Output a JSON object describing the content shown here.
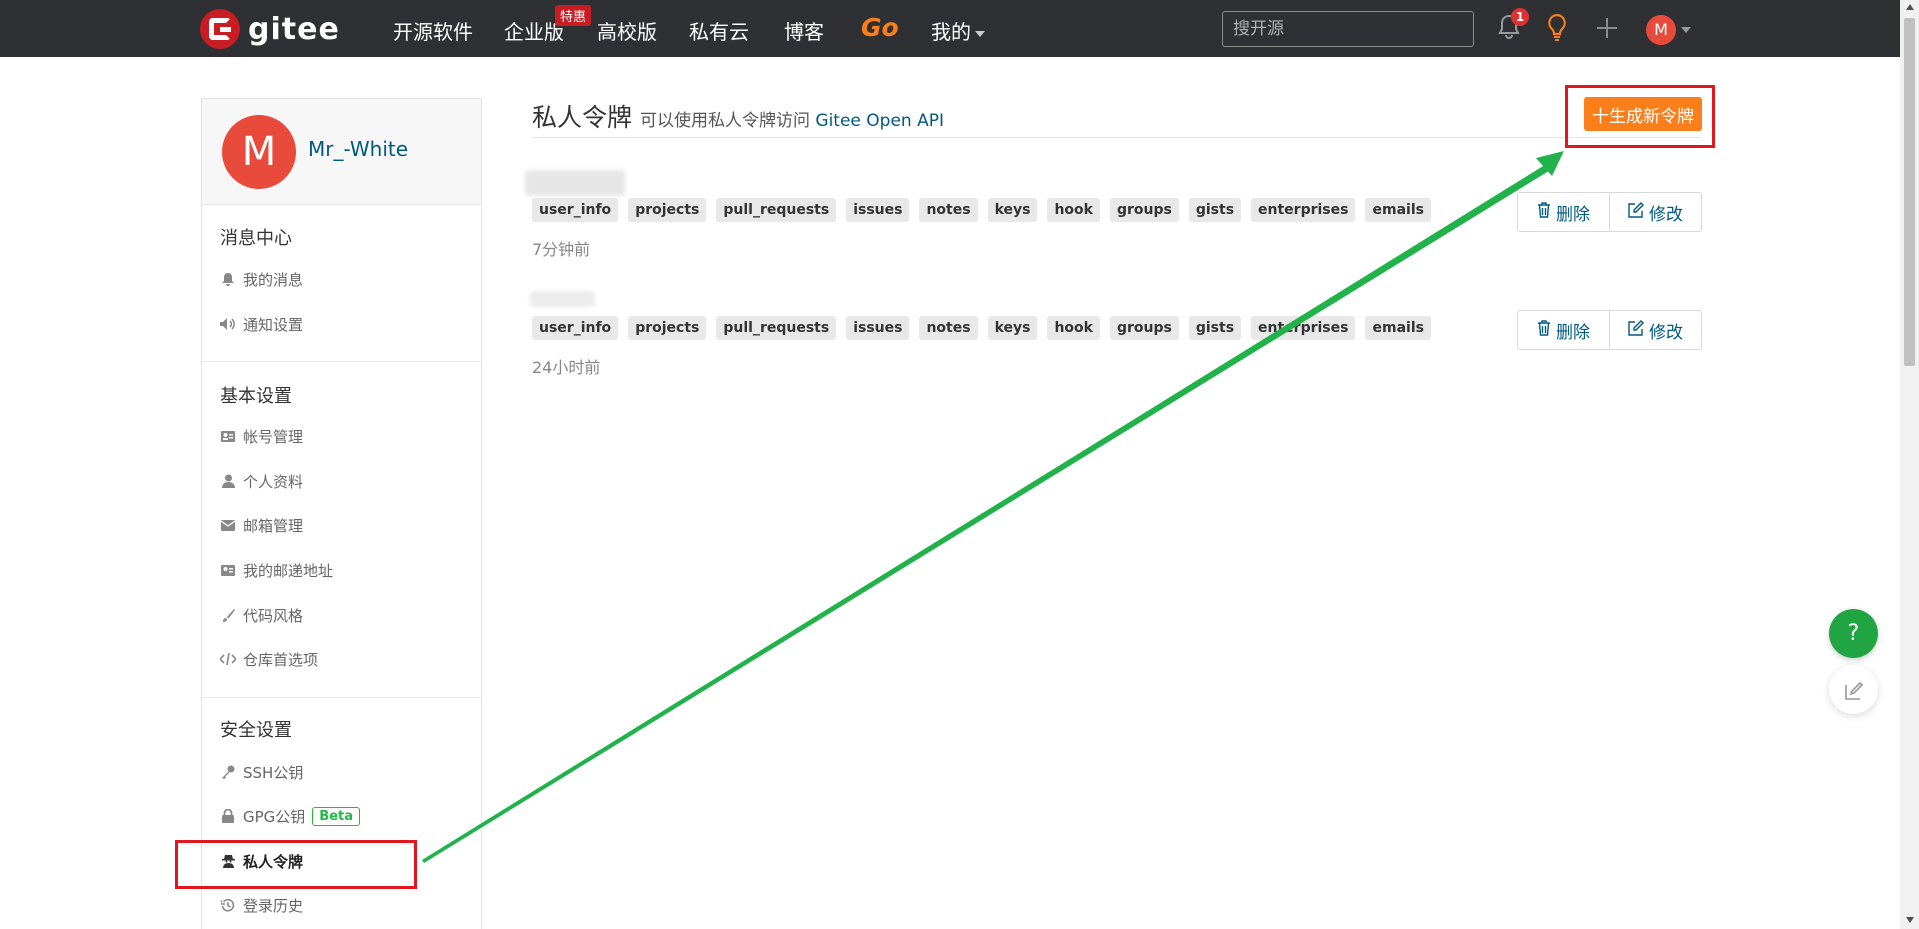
{
  "nav": {
    "logo_text": "gitee",
    "items": [
      "开源软件",
      "企业版",
      "高校版",
      "私有云",
      "博客"
    ],
    "enterprise_badge": "特惠",
    "go_label": "Go",
    "mine_label": "我的",
    "search_placeholder": "搜开源",
    "notification_count": "1",
    "avatar_letter": "M"
  },
  "sidebar": {
    "avatar_letter": "M",
    "username": "Mr_-White",
    "sections": [
      {
        "title": "消息中心",
        "items": [
          {
            "label": "我的消息",
            "icon": "bell-icon"
          },
          {
            "label": "通知设置",
            "icon": "speaker-icon"
          }
        ]
      },
      {
        "title": "基本设置",
        "items": [
          {
            "label": "帐号管理",
            "icon": "id-card-icon"
          },
          {
            "label": "个人资料",
            "icon": "user-icon"
          },
          {
            "label": "邮箱管理",
            "icon": "mail-icon"
          },
          {
            "label": "我的邮递地址",
            "icon": "address-card-icon"
          },
          {
            "label": "代码风格",
            "icon": "brush-icon"
          },
          {
            "label": "仓库首选项",
            "icon": "code-icon"
          }
        ]
      },
      {
        "title": "安全设置",
        "items": [
          {
            "label": "SSH公钥",
            "icon": "key-icon"
          },
          {
            "label": "GPG公钥",
            "icon": "lock-icon",
            "badge": "Beta"
          },
          {
            "label": "私人令牌",
            "icon": "user-secret-icon",
            "active": true
          },
          {
            "label": "登录历史",
            "icon": "history-icon"
          }
        ]
      }
    ]
  },
  "main": {
    "title": "私人令牌",
    "subtitle": "可以使用私人令牌访问",
    "subtitle_api": "Gitee Open API",
    "generate_button": "十生成新令牌",
    "tokens": [
      {
        "scopes": [
          "user_info",
          "projects",
          "pull_requests",
          "issues",
          "notes",
          "keys",
          "hook",
          "groups",
          "gists",
          "enterprises",
          "emails"
        ],
        "time": "7分钟前",
        "delete_label": "删除",
        "edit_label": "修改"
      },
      {
        "scopes": [
          "user_info",
          "projects",
          "pull_requests",
          "issues",
          "notes",
          "keys",
          "hook",
          "groups",
          "gists",
          "enterprises",
          "emails"
        ],
        "time": "24小时前",
        "delete_label": "删除",
        "edit_label": "修改"
      }
    ]
  },
  "floating": {
    "help_label": "?"
  },
  "colors": {
    "nav_bg": "#2e3033",
    "brand_red": "#c71d23",
    "accent_orange": "#fa7e19",
    "link_blue": "#005980",
    "annotation_red": "#e0171f",
    "annotation_green": "#21b24b"
  }
}
